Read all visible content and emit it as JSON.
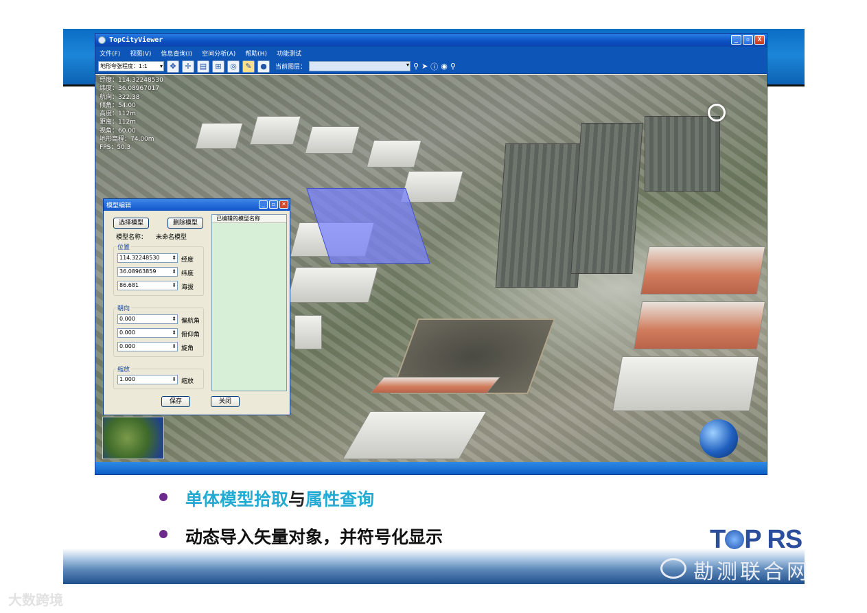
{
  "window": {
    "title": "TopCityViewer",
    "controls": [
      "_",
      "▫",
      "X"
    ]
  },
  "menu": [
    "文件(F)",
    "视图(V)",
    "信息查询(I)",
    "空间分析(A)",
    "帮助(H)",
    "功能测试"
  ],
  "toolbar": {
    "terrain_select": "地形夸张程度：1:1",
    "current_layer_label": "当前图层：",
    "current_layer_value": ""
  },
  "nav_info": [
    "经度：114.32248530",
    "纬度：36.08967017",
    "航向：322.38",
    "倾角：54.00",
    "高度：112m",
    "距离：112m",
    "视角：60.00",
    "地形高程：74.00m",
    "FPS：50.3"
  ],
  "dialog": {
    "title": "模型编辑",
    "select_button": "选择模型",
    "delete_button": "删除模型",
    "model_name_label": "模型名称：",
    "model_name_value": "未命名模型",
    "position_group": "位置",
    "longitude_value": "114.32248530",
    "longitude_label": "经度",
    "latitude_value": "36.08963859",
    "latitude_label": "纬度",
    "altitude_value": "86.681",
    "altitude_label": "海拔",
    "orientation_group": "朝向",
    "heading_value": "0.000",
    "heading_label": "偏航角",
    "pitch_value": "0.000",
    "pitch_label": "俯仰角",
    "roll_value": "0.000",
    "roll_label": "旋角",
    "scale_group": "缩放",
    "scale_value": "1.000",
    "scale_label": "缩放",
    "list_header": "已编辑的模型名称",
    "save_button": "保存",
    "close_button": "关闭"
  },
  "bullets": {
    "line1_part1": "单体模型拾取",
    "line1_part2": "与",
    "line1_part3": "属性查询",
    "line2": "动态导入矢量对象，并符号化显示"
  },
  "logo": {
    "part1": "T",
    "part2": "P RS"
  },
  "watermark": {
    "right": "勘测联合网",
    "left": "大数跨境"
  },
  "colors": {
    "accent_blue": "#22aad3",
    "bullet_purple": "#6b2a8c",
    "logo_blue": "#2a4d9c"
  }
}
